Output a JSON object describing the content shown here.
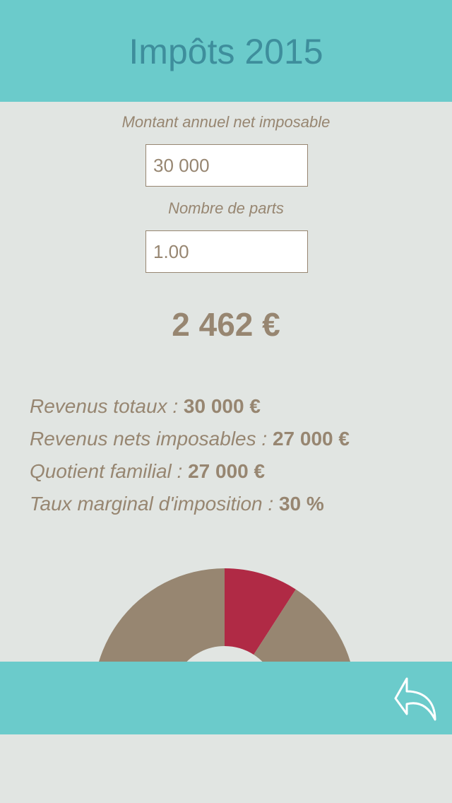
{
  "header": {
    "title": "Impôts 2015"
  },
  "form": {
    "income_label": "Montant annuel net imposable",
    "income_value": "30 000",
    "parts_label": "Nombre de parts",
    "parts_value": "1.00"
  },
  "result": {
    "tax": "2 462 €"
  },
  "stats": [
    {
      "label": "Revenus totaux : ",
      "value": "30 000 €"
    },
    {
      "label": "Revenus nets imposables : ",
      "value": "27 000 €"
    },
    {
      "label": "Quotient familial : ",
      "value": "27 000 €"
    },
    {
      "label": "Taux marginal d'imposition : ",
      "value": "30 %"
    }
  ],
  "chart_data": {
    "type": "pie",
    "slices": [
      {
        "share": 0.0912,
        "color": "#b02a45"
      },
      {
        "share": 0.9088,
        "color": "#978671"
      }
    ]
  },
  "colors": {
    "header_bg": "#6bcbcb",
    "title": "#3e8e9c",
    "text": "#978671",
    "accent": "#b02a45",
    "background": "#e1e5e2"
  },
  "footer": {
    "back_icon": "reply-arrow-icon"
  }
}
